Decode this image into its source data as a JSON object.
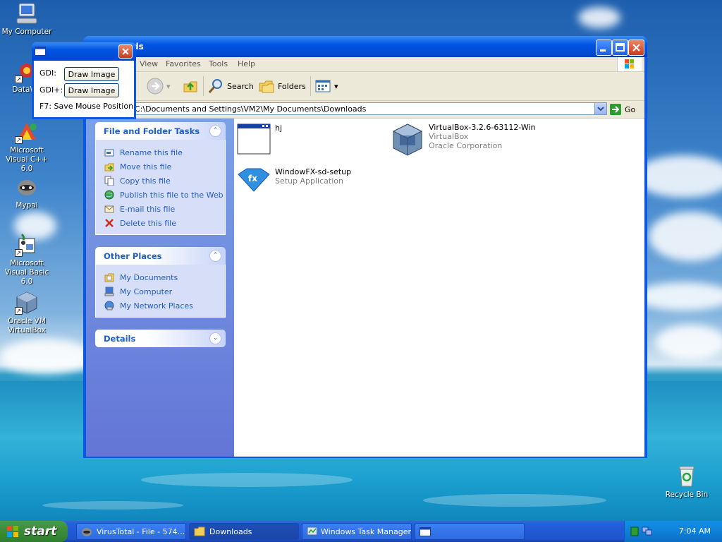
{
  "desktop": {
    "icons": [
      {
        "label": "My Computer"
      },
      {
        "label": "DataWa"
      },
      {
        "label": "Microsoft Visual C++ 6.0"
      },
      {
        "label": "Mypal"
      },
      {
        "label": "Microsoft Visual Basic 6.0"
      },
      {
        "label": "Oracle VM VirtualBox"
      },
      {
        "label": "Recycle Bin"
      }
    ]
  },
  "explorer": {
    "title": "ds",
    "menu": [
      "View",
      "Favorites",
      "Tools",
      "Help"
    ],
    "toolbar": {
      "search": "Search",
      "folders": "Folders"
    },
    "address": "C:\\Documents and Settings\\VM2\\My Documents\\Downloads",
    "go_label": "Go",
    "file_tasks": {
      "title": "File and Folder Tasks",
      "items": [
        {
          "label": "Rename this file",
          "icon": "rename-icon"
        },
        {
          "label": "Move this file",
          "icon": "move-icon"
        },
        {
          "label": "Copy this file",
          "icon": "copy-icon"
        },
        {
          "label": "Publish this file to the Web",
          "icon": "publish-icon"
        },
        {
          "label": "E-mail this file",
          "icon": "email-icon"
        },
        {
          "label": "Delete this file",
          "icon": "delete-icon"
        }
      ]
    },
    "other_places": {
      "title": "Other Places",
      "items": [
        {
          "label": "My Documents",
          "icon": "my-documents-icon"
        },
        {
          "label": "My Computer",
          "icon": "my-computer-icon"
        },
        {
          "label": "My Network Places",
          "icon": "network-icon"
        }
      ]
    },
    "details": {
      "title": "Details"
    },
    "files": [
      {
        "name": "hj",
        "line2": "",
        "line3": ""
      },
      {
        "name": "VirtualBox-3.2.6-63112-Win",
        "line2": "VirtualBox",
        "line3": "Oracle Corporation"
      },
      {
        "name": "WindowFX-sd-setup",
        "line2": "Setup Application",
        "line3": ""
      }
    ]
  },
  "tool_window": {
    "gdi_label": "GDI:",
    "gdiplus_label": "GDI+:",
    "btn1": "Draw Image",
    "btn2": "Draw Image",
    "hint": "F7: Save Mouse Position"
  },
  "taskbar": {
    "start": "start",
    "tasks": [
      "VirusTotal - File - 574...",
      "Downloads",
      "Windows Task Manager",
      ""
    ],
    "clock": "7:04 AM"
  }
}
